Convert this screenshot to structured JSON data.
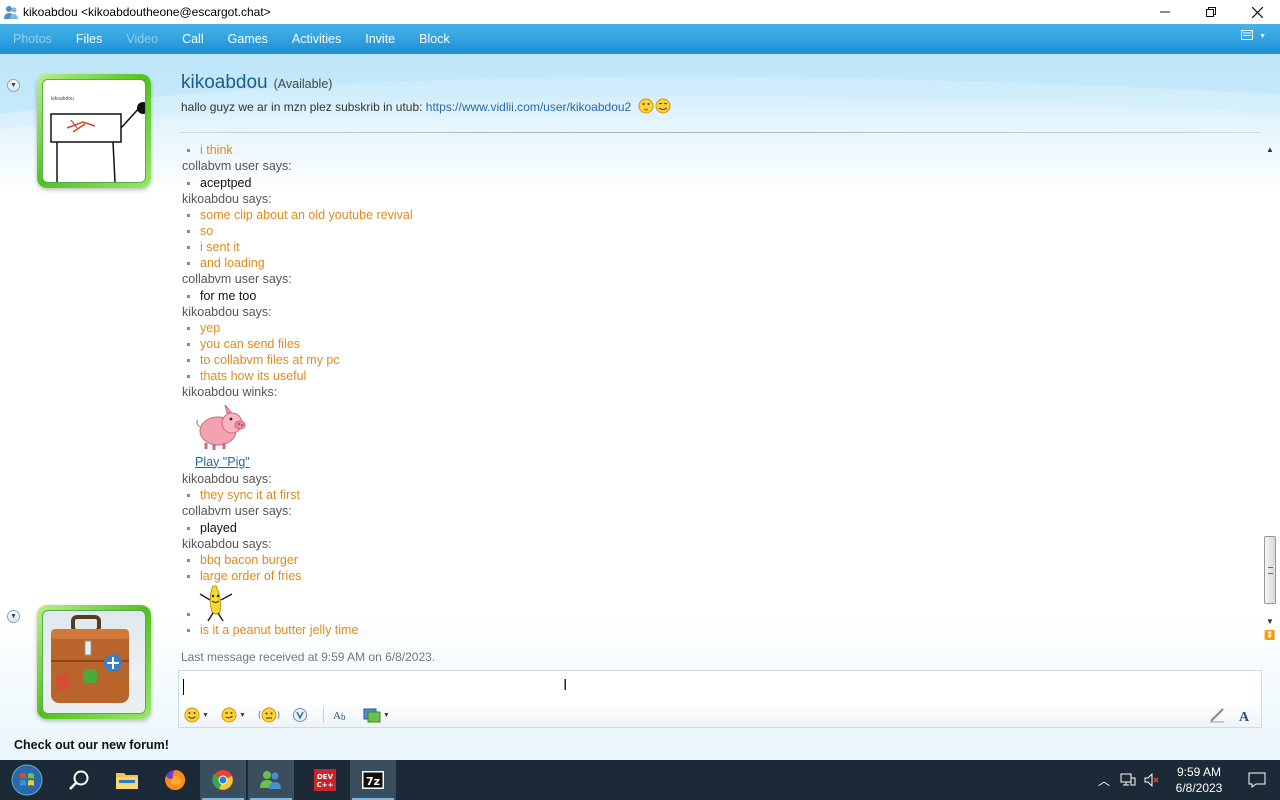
{
  "window": {
    "title": "kikoabdou <kikoabdoutheone@escargot.chat>"
  },
  "toolbar": {
    "items": [
      {
        "label": "Photos",
        "enabled": false
      },
      {
        "label": "Files",
        "enabled": true
      },
      {
        "label": "Video",
        "enabled": false
      },
      {
        "label": "Call",
        "enabled": true
      },
      {
        "label": "Games",
        "enabled": true
      },
      {
        "label": "Activities",
        "enabled": true
      },
      {
        "label": "Invite",
        "enabled": true
      },
      {
        "label": "Block",
        "enabled": true
      }
    ]
  },
  "contact": {
    "name": "kikoabdou",
    "status": "(Available)",
    "psm_text": "hallo guyz we ar in mzn plez subskrib in utub: ",
    "psm_link": "https://www.vidlii.com/user/kikoabdou2",
    "avatar_label": "kikoabdou"
  },
  "conversation": {
    "entries": [
      {
        "kind": "msg",
        "who": "me",
        "text": "i think"
      },
      {
        "kind": "says",
        "text": "collabvm user says:"
      },
      {
        "kind": "msg",
        "who": "them",
        "text": "aceptped"
      },
      {
        "kind": "says",
        "text": "kikoabdou says:"
      },
      {
        "kind": "msg",
        "who": "me",
        "text": "some clip about an old youtube revival"
      },
      {
        "kind": "msg",
        "who": "me",
        "text": "so"
      },
      {
        "kind": "msg",
        "who": "me",
        "text": "i sent it"
      },
      {
        "kind": "msg",
        "who": "me",
        "text": "and loading"
      },
      {
        "kind": "says",
        "text": "collabvm user says:"
      },
      {
        "kind": "msg",
        "who": "them",
        "text": "for me too"
      },
      {
        "kind": "says",
        "text": "kikoabdou says:"
      },
      {
        "kind": "msg",
        "who": "me",
        "text": "yep"
      },
      {
        "kind": "msg",
        "who": "me",
        "text": "you can send files"
      },
      {
        "kind": "msg",
        "who": "me",
        "text": "to collabvm files at my pc"
      },
      {
        "kind": "msg",
        "who": "me",
        "text": "thats how its useful"
      },
      {
        "kind": "says",
        "text": "kikoabdou winks:"
      },
      {
        "kind": "wink",
        "link": "Play \"Pig\""
      },
      {
        "kind": "says",
        "text": "kikoabdou says:"
      },
      {
        "kind": "msg",
        "who": "me",
        "text": "they sync it at first"
      },
      {
        "kind": "says",
        "text": "collabvm user says:"
      },
      {
        "kind": "msg",
        "who": "them",
        "text": "played"
      },
      {
        "kind": "says",
        "text": "kikoabdou says:"
      },
      {
        "kind": "msg",
        "who": "me",
        "text": "bbq bacon burger"
      },
      {
        "kind": "msg",
        "who": "me",
        "text": "large order of fries"
      },
      {
        "kind": "emote"
      },
      {
        "kind": "msg",
        "who": "me",
        "text": "is it a peanut butter jelly time"
      }
    ],
    "last_received": "Last message received at 9:59 AM on 6/8/2023."
  },
  "input": {
    "value": "",
    "placeholder": ""
  },
  "footer": {
    "forum_link": "Check out our new forum!"
  },
  "taskbar": {
    "apps": [
      "start-orb",
      "search",
      "file-explorer",
      "firefox",
      "chrome",
      "messenger",
      "dev-cpp",
      "7zip"
    ],
    "clock_time": "9:59 AM",
    "clock_date": "6/8/2023"
  },
  "colors": {
    "toolbar_top": "#46b4ea",
    "toolbar_bottom": "#1e8fd6",
    "my_message": "#e08a1e",
    "their_message": "#111111",
    "contact_name": "#1f5c8a",
    "link": "#1d6aa5",
    "taskbar": "#1b2a36"
  }
}
